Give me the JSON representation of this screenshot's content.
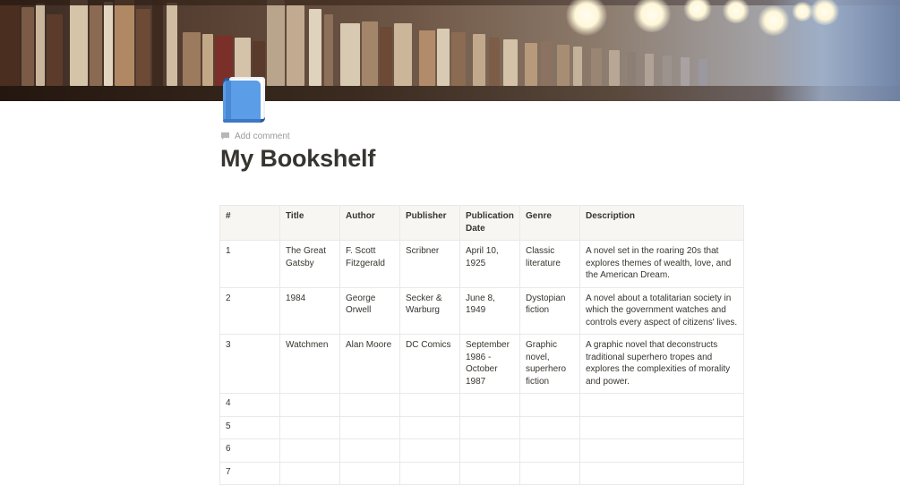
{
  "page": {
    "title": "My Bookshelf",
    "add_comment": "Add comment",
    "icon": "blue-book-icon"
  },
  "table": {
    "columns": [
      "#",
      "Title",
      "Author",
      "Publisher",
      "Publication Date",
      "Genre",
      "Description"
    ],
    "rows": [
      [
        "1",
        "The Great Gatsby",
        "F. Scott Fitzgerald",
        "Scribner",
        "April 10, 1925",
        "Classic literature",
        "A novel set in the roaring 20s that explores themes of wealth, love, and the American Dream."
      ],
      [
        "2",
        "1984",
        "George Orwell",
        "Secker & Warburg",
        "June 8, 1949",
        "Dystopian fiction",
        "A novel about a totalitarian society in which the government watches and controls every aspect of citizens' lives."
      ],
      [
        "3",
        "Watchmen",
        "Alan Moore",
        "DC Comics",
        "September 1986 - October 1987",
        "Graphic novel, superhero fiction",
        "A graphic novel that deconstructs traditional superhero tropes and explores the complexities of morality and power."
      ],
      [
        "4",
        "",
        "",
        "",
        "",
        "",
        ""
      ],
      [
        "5",
        "",
        "",
        "",
        "",
        "",
        ""
      ],
      [
        "6",
        "",
        "",
        "",
        "",
        "",
        ""
      ],
      [
        "7",
        "",
        "",
        "",
        "",
        "",
        ""
      ]
    ]
  },
  "colors": {
    "text": "#37352f",
    "muted": "#9b9a97",
    "header_bg": "#f7f6f3",
    "border": "#e9e9e7",
    "icon_blue": "#4a90e2"
  }
}
